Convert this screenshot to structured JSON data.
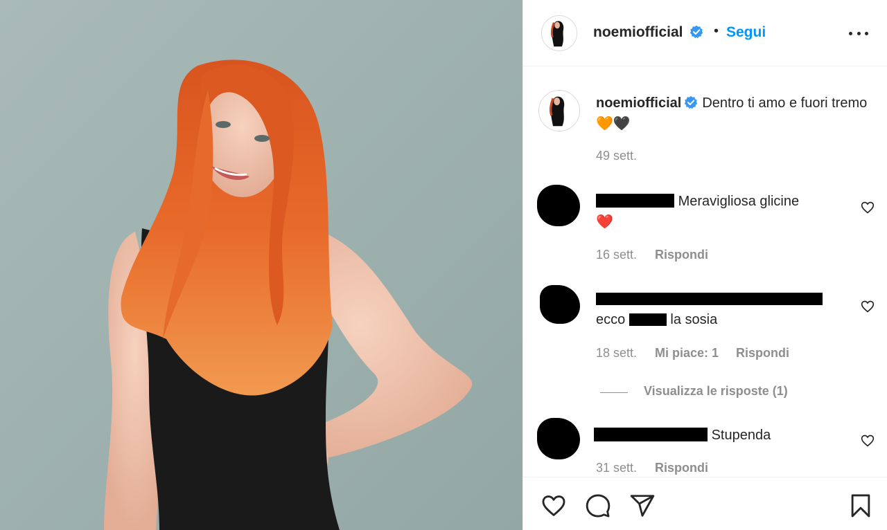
{
  "post": {
    "username": "noemiofficial",
    "dot": "•",
    "follow_label": "Segui",
    "caption": "Dentro ti amo e fuori tremo",
    "caption_emoji": "🧡🖤",
    "caption_age": "49 sett."
  },
  "comments": [
    {
      "text": "Meravigliosa glicine",
      "emoji": "❤️",
      "age": "16 sett.",
      "reply_label": "Rispondi"
    },
    {
      "prefix": "ecco",
      "text": "la sosia",
      "age": "18 sett.",
      "likes": "Mi piace: 1",
      "reply_label": "Rispondi",
      "view_replies": "Visualizza le risposte (1)"
    },
    {
      "text": "Stupenda",
      "age": "31 sett.",
      "reply_label": "Rispondi"
    }
  ],
  "icons": {
    "verified": "verified-badge-icon",
    "more": "more-options-icon",
    "like": "heart-icon",
    "comment": "comment-icon",
    "share": "paper-plane-icon",
    "save": "bookmark-icon"
  },
  "colors": {
    "accent": "#0095f6",
    "text": "#262626",
    "muted": "#8e8e8e",
    "border": "#efefef"
  }
}
